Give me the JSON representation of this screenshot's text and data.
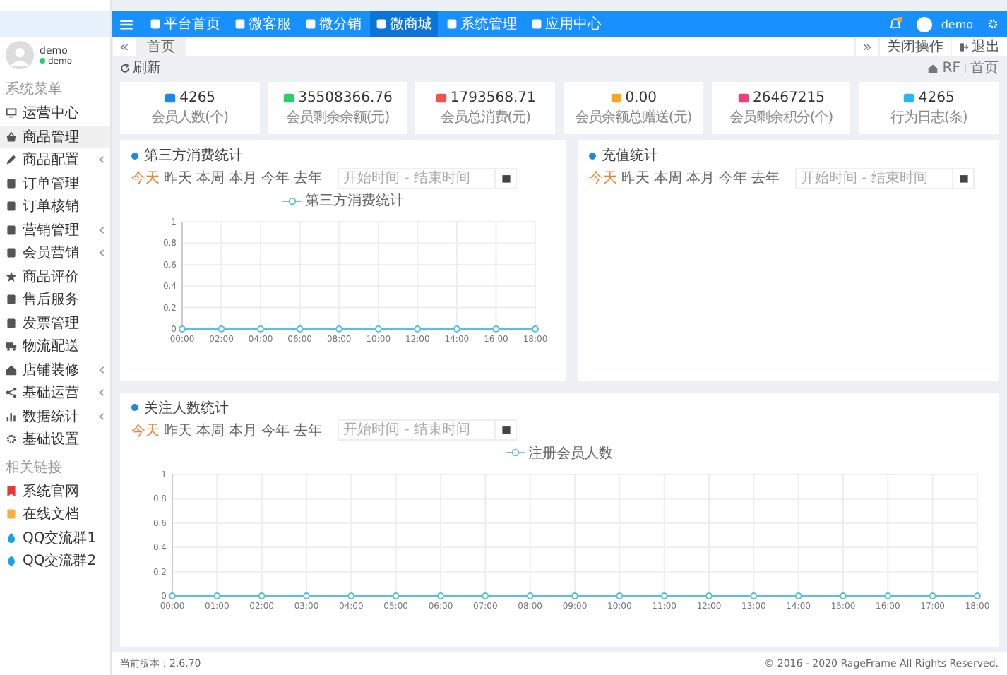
{
  "top_nav": {
    "items": [
      {
        "label": "平台首页",
        "selected": false
      },
      {
        "label": "微客服",
        "selected": false
      },
      {
        "label": "微分销",
        "selected": false
      },
      {
        "label": "微商城",
        "selected": true
      },
      {
        "label": "系统管理",
        "selected": false
      },
      {
        "label": "应用中心",
        "selected": false
      }
    ],
    "user": {
      "name": "demo"
    }
  },
  "sidebar": {
    "user": {
      "name": "demo",
      "status": "demo"
    },
    "sections": [
      {
        "title": "系统菜单",
        "items": [
          {
            "label": "运营中心",
            "has_children": false,
            "selected": false
          },
          {
            "label": "商品管理",
            "has_children": false,
            "selected": true
          },
          {
            "label": "商品配置",
            "has_children": true,
            "selected": false
          },
          {
            "label": "订单管理",
            "has_children": false,
            "selected": false
          },
          {
            "label": "订单核销",
            "has_children": false,
            "selected": false
          },
          {
            "label": "营销管理",
            "has_children": true,
            "selected": false
          },
          {
            "label": "会员营销",
            "has_children": true,
            "selected": false
          },
          {
            "label": "商品评价",
            "has_children": false,
            "selected": false
          },
          {
            "label": "售后服务",
            "has_children": false,
            "selected": false
          },
          {
            "label": "发票管理",
            "has_children": false,
            "selected": false
          },
          {
            "label": "物流配送",
            "has_children": false,
            "selected": false
          },
          {
            "label": "店铺装修",
            "has_children": true,
            "selected": false
          },
          {
            "label": "基础运营",
            "has_children": true,
            "selected": false
          },
          {
            "label": "数据统计",
            "has_children": true,
            "selected": false
          },
          {
            "label": "基础设置",
            "has_children": false,
            "selected": false
          }
        ]
      },
      {
        "title": "相关链接",
        "items": [
          {
            "label": "系统官网",
            "has_children": false,
            "selected": false
          },
          {
            "label": "在线文档",
            "has_children": false,
            "selected": false
          },
          {
            "label": "QQ交流群1",
            "has_children": false,
            "selected": false
          },
          {
            "label": "QQ交流群2",
            "has_children": false,
            "selected": false
          }
        ]
      }
    ]
  },
  "tabs_bar": {
    "tabs": [
      {
        "label": "首页",
        "selected": true
      }
    ],
    "close_label": "关闭操作",
    "logout_label": "退出"
  },
  "toolbar": {
    "refresh": "刷新",
    "breadcrumb": [
      "RF",
      "首页"
    ]
  },
  "stats": [
    {
      "value": "4265",
      "label": "会员人数(个)"
    },
    {
      "value": "35508366.76",
      "label": "会员剩余余额(元)"
    },
    {
      "value": "1793568.71",
      "label": "会员总消费(元)"
    },
    {
      "value": "0.00",
      "label": "会员余额总赠送(元)"
    },
    {
      "value": "26467215",
      "label": "会员剩余积分(个)"
    },
    {
      "value": "4265",
      "label": "行为日志(条)"
    }
  ],
  "panels": [
    {
      "title": "第三方消费统计",
      "filters": [
        {
          "label": "今天",
          "selected": true
        },
        {
          "label": "昨天",
          "selected": false
        },
        {
          "label": "本周",
          "selected": false
        },
        {
          "label": "本月",
          "selected": false
        },
        {
          "label": "今年",
          "selected": false
        },
        {
          "label": "去年",
          "selected": false
        }
      ],
      "date_range": {
        "placeholder": "开始时间 - 结束时间"
      },
      "chart_data": {
        "type": "line",
        "categories": [
          "00:00",
          "02:00",
          "04:00",
          "06:00",
          "08:00",
          "10:00",
          "12:00",
          "14:00",
          "16:00",
          "18:00"
        ],
        "series": [
          {
            "name": "第三方消费统计",
            "color": "#5bc0de",
            "marker": true,
            "values": [
              0,
              0,
              0,
              0,
              0,
              0,
              0,
              0,
              0,
              0
            ]
          }
        ],
        "ylim": [
          0,
          1
        ],
        "yticks": [
          0,
          0.2,
          0.4,
          0.6,
          0.8,
          1
        ],
        "grid": true
      }
    },
    {
      "title": "充值统计",
      "filters": [
        {
          "label": "今天",
          "selected": true
        },
        {
          "label": "昨天",
          "selected": false
        },
        {
          "label": "本周",
          "selected": false
        },
        {
          "label": "本月",
          "selected": false
        },
        {
          "label": "今年",
          "selected": false
        },
        {
          "label": "去年",
          "selected": false
        }
      ],
      "date_range": {
        "placeholder": "开始时间 - 结束时间"
      }
    },
    {
      "title": "关注人数统计",
      "filters": [
        {
          "label": "今天",
          "selected": true
        },
        {
          "label": "昨天",
          "selected": false
        },
        {
          "label": "本周",
          "selected": false
        },
        {
          "label": "本月",
          "selected": false
        },
        {
          "label": "今年",
          "selected": false
        },
        {
          "label": "去年",
          "selected": false
        }
      ],
      "date_range": {
        "placeholder": "开始时间 - 结束时间"
      },
      "chart_data": {
        "type": "line",
        "categories": [
          "00:00",
          "01:00",
          "02:00",
          "03:00",
          "04:00",
          "05:00",
          "06:00",
          "07:00",
          "08:00",
          "09:00",
          "10:00",
          "11:00",
          "12:00",
          "13:00",
          "14:00",
          "15:00",
          "16:00",
          "17:00",
          "18:00"
        ],
        "series": [
          {
            "name": "注册会员人数",
            "color": "#5bc0de",
            "marker": true,
            "values": [
              0,
              0,
              0,
              0,
              0,
              0,
              0,
              0,
              0,
              0,
              0,
              0,
              0,
              0,
              0,
              0,
              0,
              0,
              0
            ]
          }
        ],
        "ylim": [
          0,
          1
        ],
        "yticks": [
          0,
          0.2,
          0.4,
          0.6,
          0.8,
          1
        ],
        "grid": true
      }
    }
  ],
  "footer": {
    "version": "当前版本：2.6.70",
    "copyright": "© 2016 - 2020 RageFrame All Rights Reserved."
  }
}
